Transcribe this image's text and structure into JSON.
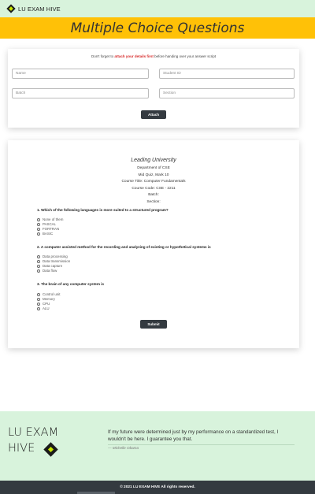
{
  "nav": {
    "brand": "LU EXAM HIVE"
  },
  "banner": {
    "title": "Multiple Choice Questions"
  },
  "details": {
    "notice_before": "Don't forget to ",
    "notice_highlight": "attach your details first",
    "notice_after": " before handing over your answer script",
    "placeholders": {
      "name": "Name",
      "student_id": "Student ID",
      "batch": "Batch",
      "section": "Section"
    },
    "attach_label": "Attach"
  },
  "exam": {
    "university": "Leading University",
    "department": "Department of CSE",
    "quiz": "Mid Quiz, Mark 10",
    "course_title": "Course Title: Computer Fundamentals",
    "course_code": "Course Code: CSE - 2211",
    "batch": "Batch:",
    "section": "Section:",
    "questions": [
      {
        "text": "1. Which of the following languages is more suited to a structured program?",
        "options": [
          "None of them",
          "PASCAL",
          "FORTRAN",
          "BASIC"
        ]
      },
      {
        "text": "2. A computer assisted method for the recording and analyzing of existing or hypothetical systems is",
        "options": [
          "Data processing",
          "Data transmission",
          "Data capture",
          "Data flow"
        ]
      },
      {
        "text": "3. The brain of any computer system is",
        "options": [
          "Control unit",
          "Memory",
          "CPU",
          "ALU"
        ]
      }
    ],
    "submit_label": "Submit"
  },
  "footer": {
    "brand_line1": "LU EXAM",
    "brand_line2": "HIVE",
    "quote": "If my future were determined just by my performance on a standardized test, I wouldn't be here. I guarantee you that.",
    "author": "— Michelle Obama",
    "copyright": "© 2021 LU EXAM HIVE All rights reserved."
  }
}
